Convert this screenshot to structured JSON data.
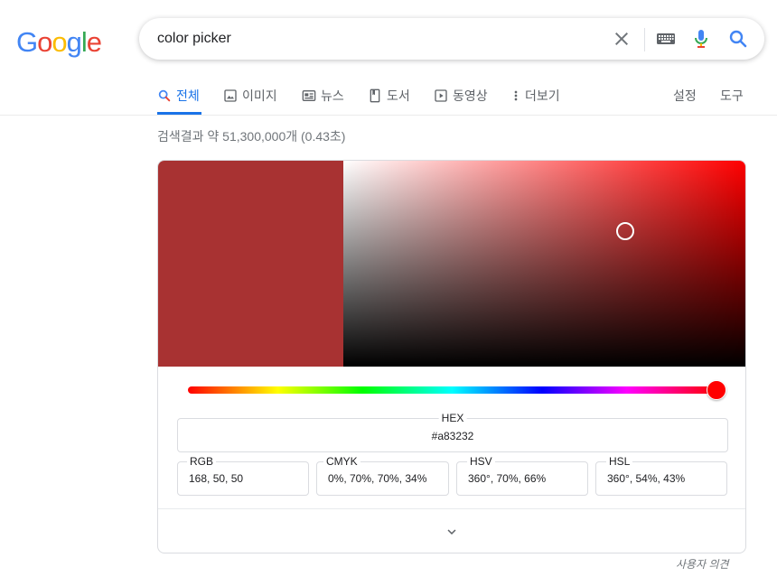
{
  "logo": {
    "text": "Google",
    "letters": [
      "G",
      "o",
      "o",
      "g",
      "l",
      "e"
    ],
    "colors": [
      "#4285f4",
      "#ea4335",
      "#fbbc05",
      "#4285f4",
      "#34a853",
      "#ea4335"
    ]
  },
  "search": {
    "query": "color picker"
  },
  "tabs": [
    {
      "label": "전체",
      "icon": "search-icon",
      "active": true
    },
    {
      "label": "이미지",
      "icon": "image-icon"
    },
    {
      "label": "뉴스",
      "icon": "news-icon"
    },
    {
      "label": "도서",
      "icon": "book-icon"
    },
    {
      "label": "동영상",
      "icon": "video-icon"
    },
    {
      "label": "더보기",
      "icon": "more-vert-icon"
    }
  ],
  "tools": {
    "settings": "설정",
    "tools": "도구"
  },
  "result_stats": "검색결과 약 51,300,000개 (0.43초)",
  "picker": {
    "swatch_color": "#a83232",
    "hue_deg": 360,
    "saturation": 0.7,
    "value": 0.66,
    "hex": {
      "label": "HEX",
      "value": "#a83232"
    },
    "fields": [
      {
        "label": "RGB",
        "value": "168, 50, 50"
      },
      {
        "label": "CMYK",
        "value": "0%, 70%, 70%, 34%"
      },
      {
        "label": "HSV",
        "value": "360°, 70%, 66%"
      },
      {
        "label": "HSL",
        "value": "360°, 54%, 43%"
      }
    ]
  },
  "feedback": "사용자 의견",
  "accent": "#1a73e8"
}
